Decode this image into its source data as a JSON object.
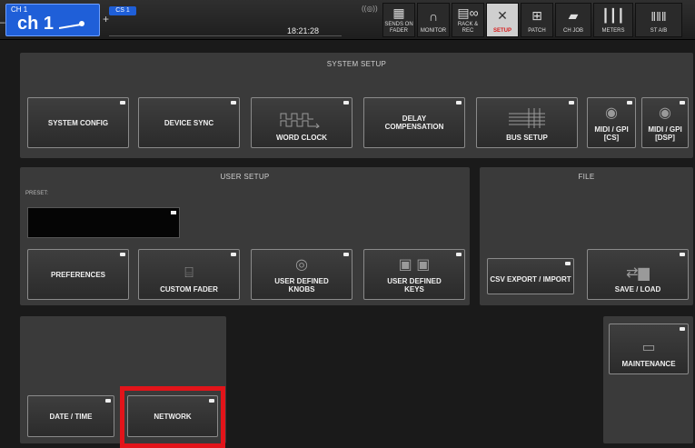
{
  "topbar": {
    "channel_number": "CH 1",
    "channel_name": "ch 1",
    "cs_badge": "CS 1",
    "time": "18:21:28",
    "buttons": [
      {
        "label": "SENDS ON FADER",
        "icon": "sends-on-fader-icon"
      },
      {
        "label": "MONITOR",
        "icon": "headphones-icon"
      },
      {
        "label": "RACK & REC",
        "icon": "rack-rec-icon"
      },
      {
        "label": "SETUP",
        "icon": "tools-icon",
        "active": true
      },
      {
        "label": "PATCH",
        "icon": "patch-icon"
      },
      {
        "label": "CH JOB",
        "icon": "ch-job-icon"
      },
      {
        "label": "METERS",
        "icon": "meters-icon"
      },
      {
        "label": "ST A/B",
        "icon": "st-ab-icon"
      }
    ]
  },
  "system_setup": {
    "title": "SYSTEM SETUP",
    "buttons": {
      "system_config": "SYSTEM CONFIG",
      "device_sync": "DEVICE SYNC",
      "word_clock": "WORD CLOCK",
      "delay_compensation": "DELAY COMPENSATION",
      "bus_setup": "BUS SETUP",
      "midi_gpi_cs": "MIDI / GPI [CS]",
      "midi_gpi_dsp": "MIDI / GPI [DSP]"
    }
  },
  "user_setup": {
    "title": "USER SETUP",
    "preset_label": "PRESET:",
    "buttons": {
      "preferences": "PREFERENCES",
      "custom_fader": "CUSTOM FADER",
      "user_defined_knobs": "USER DEFINED KNOBS",
      "user_defined_keys": "USER DEFINED KEYS"
    }
  },
  "file": {
    "title": "FILE",
    "buttons": {
      "csv": "CSV EXPORT / IMPORT",
      "save_load": "SAVE / LOAD"
    }
  },
  "bottom": {
    "date_time": "DATE / TIME",
    "network": "NETWORK",
    "maintenance": "MAINTENANCE"
  },
  "colors": {
    "channel_blue": "#1f5fd8",
    "highlight_red": "#e2141a",
    "active_label_red": "#d81c1c"
  }
}
